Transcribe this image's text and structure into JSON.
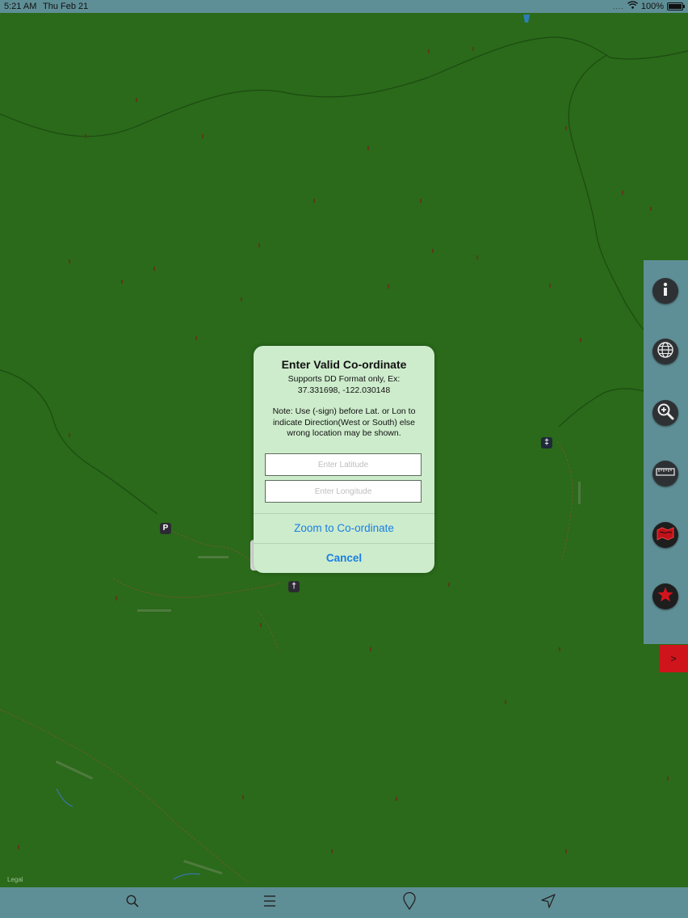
{
  "status_bar": {
    "time": "5:21 AM",
    "date": "Thu Feb 21",
    "signal": "....",
    "battery": "100%"
  },
  "map": {
    "legal_label": "Legal",
    "markers": [
      {
        "name": "parking-marker",
        "glyph": "P"
      },
      {
        "name": "hiker-marker",
        "glyph": "†"
      },
      {
        "name": "tower-marker",
        "glyph": "‡"
      }
    ]
  },
  "dialog": {
    "title": "Enter Valid Co-ordinate",
    "message_line1": "Supports DD Format only, Ex:",
    "message_line2": "37.331698, -122.030148",
    "note_line1": "Note: Use (-sign) before Lat. or Lon to",
    "note_line2": "indicate Direction(West or South) else",
    "note_line3": "wrong location may be shown.",
    "latitude": {
      "value": "",
      "placeholder": "Enter Latitude"
    },
    "longitude": {
      "value": "",
      "placeholder": "Enter Longitude"
    },
    "zoom_label": "Zoom to Co-ordinate",
    "cancel_label": "Cancel"
  },
  "side_toolbar": {
    "buttons": [
      {
        "name": "info-icon"
      },
      {
        "name": "globe-icon"
      },
      {
        "name": "zoom-in-icon"
      },
      {
        "name": "ruler-icon"
      },
      {
        "name": "map-layer-icon"
      },
      {
        "name": "star-icon"
      }
    ],
    "toggle_label": ">"
  },
  "tab_bar": {
    "tabs": [
      {
        "name": "search-icon"
      },
      {
        "name": "menu-icon"
      },
      {
        "name": "pin-icon"
      },
      {
        "name": "location-arrow-icon"
      }
    ]
  },
  "colors": {
    "map_green": "#2a6a1a",
    "bar_teal": "#5f8f96",
    "dialog_bg": "#cdeccc",
    "action_blue": "#1a7ee6",
    "toggle_red": "#d0141b"
  }
}
